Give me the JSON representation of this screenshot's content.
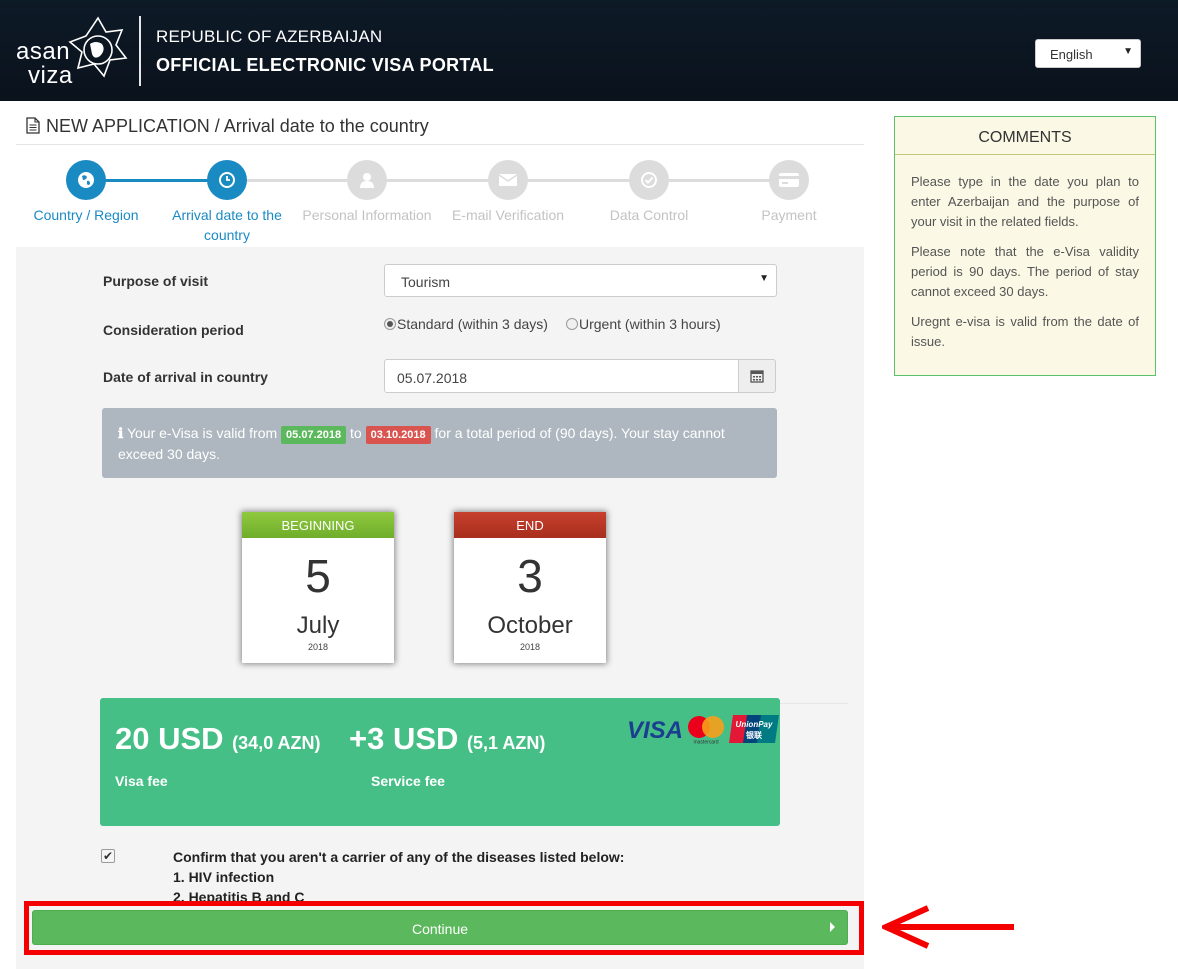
{
  "header": {
    "logo_top": "asan",
    "logo_bottom": "viza",
    "country": "REPUBLIC OF AZERBAIJAN",
    "portal": "OFFICIAL ELECTRONIC VISA PORTAL",
    "language": "English"
  },
  "page": {
    "title": "NEW APPLICATION / Arrival date to the country"
  },
  "steps": [
    {
      "label": "Country / Region",
      "state": "active",
      "icon": "globe-icon"
    },
    {
      "label": "Arrival date to the country",
      "state": "active",
      "icon": "clock-icon"
    },
    {
      "label": "Personal Information",
      "state": "inactive",
      "icon": "user-icon"
    },
    {
      "label": "E-mail Verification",
      "state": "inactive",
      "icon": "envelope-icon"
    },
    {
      "label": "Data Control",
      "state": "inactive",
      "icon": "check-circle-icon"
    },
    {
      "label": "Payment",
      "state": "inactive",
      "icon": "credit-card-icon"
    }
  ],
  "form": {
    "purpose_label": "Purpose of visit",
    "purpose_value": "Tourism",
    "period_label": "Consideration period",
    "period_standard": "Standard (within 3 days)",
    "period_urgent": "Urgent (within 3 hours)",
    "period_selected": "standard",
    "arrival_label": "Date of arrival in country",
    "arrival_value": "05.07.2018"
  },
  "validity": {
    "text_before": "Your e-Visa is valid from",
    "from": "05.07.2018",
    "to_word": "to",
    "to": "03.10.2018",
    "text_after": "for a total period of (90 days). Your stay cannot exceed 30 days."
  },
  "calendar": {
    "beginning": {
      "header": "BEGINNING",
      "day": "5",
      "month": "July",
      "year": "2018"
    },
    "end": {
      "header": "END",
      "day": "3",
      "month": "October",
      "year": "2018"
    }
  },
  "fees": {
    "visa_amount": "20 USD",
    "visa_azn": "(34,0 AZN)",
    "plus": "+",
    "service_amount": "3 USD",
    "service_azn": "(5,1 AZN)",
    "visa_label": "Visa fee",
    "service_label": "Service fee",
    "card_logos": [
      "VISA",
      "mastercard",
      "UnionPay",
      "银联"
    ]
  },
  "confirm": {
    "checked": true,
    "text": "Confirm that you aren't a carrier of any of the diseases listed below:",
    "items": [
      "1. HIV infection",
      "2. Hepatitis B and C"
    ]
  },
  "continue_label": "Continue",
  "comments": {
    "title": "COMMENTS",
    "paragraphs": [
      "Please type in the date you plan to enter Azerbaijan and the purpose of your visit in the related fields.",
      "Please note that the e-Visa validity period is 90 days. The period of stay cannot exceed 30 days.",
      "Uregnt e-visa is valid from the date of issue."
    ]
  },
  "colors": {
    "header_bg": "#0d1a27",
    "step_active": "#1a8ac3",
    "step_inactive": "#dcdcdc",
    "fee_bg": "#46bf87",
    "continue_bg": "#5cb85c",
    "highlight_red": "#f40000",
    "comments_bg": "#fbf8e5"
  }
}
